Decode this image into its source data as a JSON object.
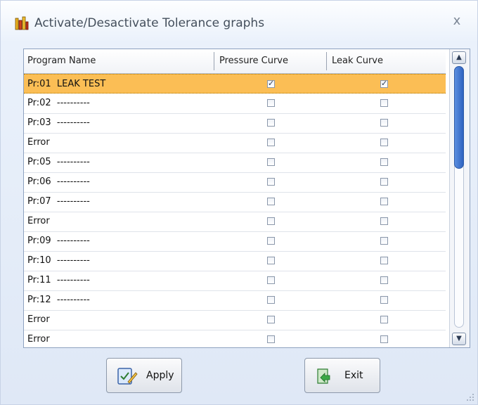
{
  "window": {
    "title": "Activate/Desactivate Tolerance graphs",
    "close_glyph": "x",
    "app_icon": "bar-chart-icon"
  },
  "table": {
    "columns": [
      "Program Name",
      "Pressure Curve",
      "Leak Curve"
    ],
    "rows": [
      {
        "name": "Pr:01  LEAK TEST",
        "pressure": true,
        "leak": true,
        "selected": true
      },
      {
        "name": "Pr:02  ----------",
        "pressure": false,
        "leak": false
      },
      {
        "name": "Pr:03  ----------",
        "pressure": false,
        "leak": false
      },
      {
        "name": "Error",
        "pressure": false,
        "leak": false
      },
      {
        "name": "Pr:05  ----------",
        "pressure": false,
        "leak": false
      },
      {
        "name": "Pr:06  ----------",
        "pressure": false,
        "leak": false
      },
      {
        "name": "Pr:07  ----------",
        "pressure": false,
        "leak": false
      },
      {
        "name": "Error",
        "pressure": false,
        "leak": false
      },
      {
        "name": "Pr:09  ----------",
        "pressure": false,
        "leak": false
      },
      {
        "name": "Pr:10  ----------",
        "pressure": false,
        "leak": false
      },
      {
        "name": "Pr:11  ----------",
        "pressure": false,
        "leak": false
      },
      {
        "name": "Pr:12  ----------",
        "pressure": false,
        "leak": false
      },
      {
        "name": "Error",
        "pressure": false,
        "leak": false
      },
      {
        "name": "Error",
        "pressure": false,
        "leak": false
      }
    ]
  },
  "buttons": {
    "apply_label": "Apply",
    "exit_label": "Exit"
  },
  "colors": {
    "selection": "#fbbe55",
    "scroll_thumb": "#2f63c0"
  }
}
